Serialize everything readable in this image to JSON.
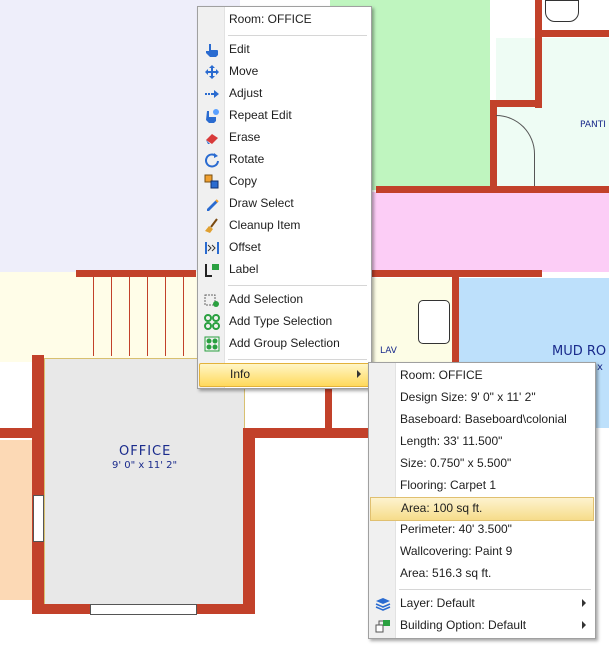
{
  "plan": {
    "office_name": "OFFICE",
    "office_size": "9' 0\" x 11' 2\"",
    "pantry_label": "PANTI",
    "lav_label": "LAV",
    "mudroom_label": "MUD RO",
    "mudroom_size_fragment": "x"
  },
  "context_menu": {
    "header": "Room: OFFICE",
    "items": [
      {
        "label": "Edit",
        "icon": "edit-hand-icon"
      },
      {
        "label": "Move",
        "icon": "move-arrows-icon"
      },
      {
        "label": "Adjust",
        "icon": "adjust-icon"
      },
      {
        "label": "Repeat Edit",
        "icon": "repeat-edit-icon"
      },
      {
        "label": "Erase",
        "icon": "eraser-icon"
      },
      {
        "label": "Rotate",
        "icon": "rotate-icon"
      },
      {
        "label": "Copy",
        "icon": "copy-icon"
      },
      {
        "label": "Draw Select",
        "icon": "draw-select-icon"
      },
      {
        "label": "Cleanup Item",
        "icon": "cleanup-broom-icon"
      },
      {
        "label": "Offset",
        "icon": "offset-icon"
      },
      {
        "label": "Label",
        "icon": "label-icon"
      }
    ],
    "selection_items": [
      {
        "label": "Add Selection",
        "icon": "add-selection-icon"
      },
      {
        "label": "Add Type Selection",
        "icon": "add-type-selection-icon"
      },
      {
        "label": "Add Group Selection",
        "icon": "add-group-selection-icon"
      }
    ],
    "info": "Info"
  },
  "info_menu": {
    "items": [
      "Room: OFFICE",
      "Design Size: 9' 0\" x 11' 2\"",
      "Baseboard: Baseboard\\colonial",
      "Length: 33' 11.500\"",
      "Size: 0.750\" x 5.500\"",
      "Flooring: Carpet 1",
      "Area:  100 sq ft.",
      "Perimeter: 40' 3.500\"",
      "Wallcovering: Paint 9",
      "Area: 516.3 sq ft."
    ],
    "highlighted_index": 6,
    "layer": "Layer: Default",
    "building_option": "Building Option: Default"
  },
  "colors": {
    "wall": "#c2412a",
    "room_lavender": "#eeeefa",
    "room_green": "#bff5bf",
    "room_pink": "#fccdf6",
    "room_cream": "#fdfde6",
    "room_blue": "#bde0fb",
    "office_fill": "#e8e8e8",
    "highlight": "#ffd95c"
  }
}
